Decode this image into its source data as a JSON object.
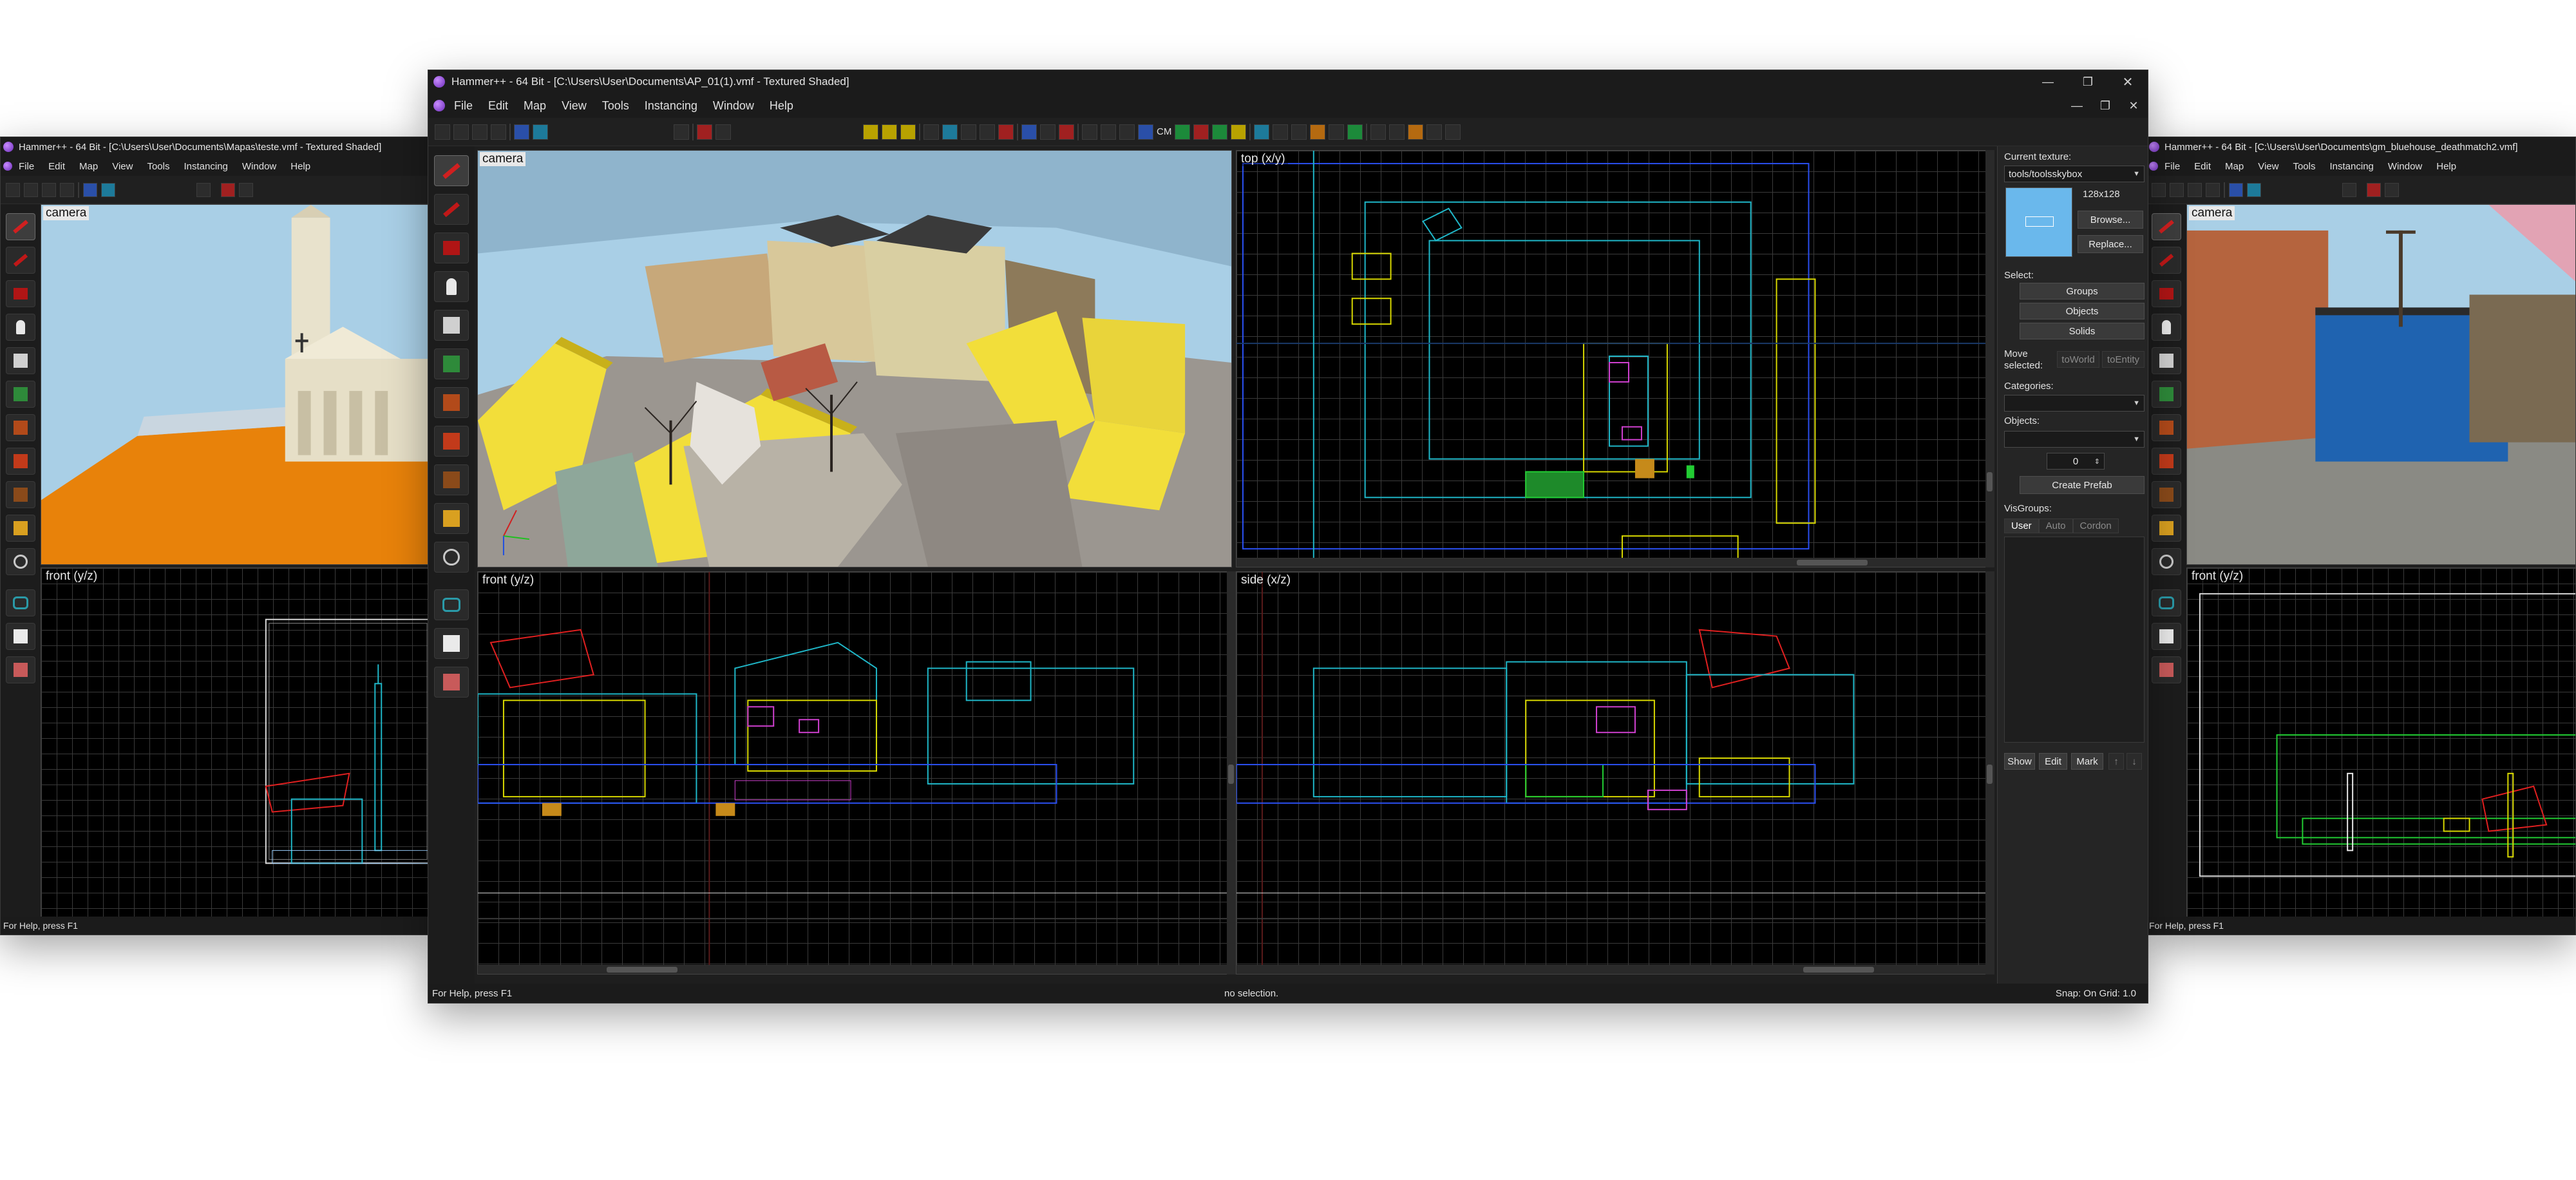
{
  "colors": {
    "window_bg": "#1e1e1e",
    "viewport_bg": "#000000",
    "grid": "#3a3a3a",
    "sky": "#a9cfe6",
    "orange_floor": "#e8820a",
    "wire_cyan": "#1fb7c8",
    "wire_yellow": "#d8d800",
    "wire_red": "#e02020",
    "wire_green": "#22cc33",
    "wire_magenta": "#d040d0",
    "wire_blue": "#2a4ff0"
  },
  "left_window": {
    "title": "Hammer++ - 64 Bit - [C:\\Users\\User\\Documents\\Mapas\\teste.vmf - Textured Shaded]",
    "menus": [
      "File",
      "Edit",
      "Map",
      "View",
      "Tools",
      "Instancing",
      "Window",
      "Help"
    ],
    "viewport_camera_label": "camera",
    "viewport_front_label": "front (y/z)",
    "status_help": "For Help, press F1"
  },
  "main_window": {
    "title": "Hammer++ - 64 Bit - [C:\\Users\\User\\Documents\\AP_01(1).vmf - Textured Shaded]",
    "menus": [
      "File",
      "Edit",
      "Map",
      "View",
      "Tools",
      "Instancing",
      "Window",
      "Help"
    ],
    "toolbar_text": "CM",
    "viewports": {
      "camera": "camera",
      "top": "top (x/y)",
      "front": "front (y/z)",
      "side": "side (x/z)"
    },
    "status": {
      "help": "For Help, press F1",
      "selection": "no selection.",
      "snap": "Snap: On Grid: 1.0"
    },
    "panel": {
      "current_texture_label": "Current texture:",
      "texture_name": "tools/toolsskybox",
      "texture_size": "128x128",
      "browse": "Browse...",
      "replace": "Replace...",
      "select_label": "Select:",
      "groups": "Groups",
      "objects_btn": "Objects",
      "solids": "Solids",
      "move_selected": "Move selected:",
      "to_world": "toWorld",
      "to_entity": "toEntity",
      "categories_label": "Categories:",
      "objects_label": "Objects:",
      "objects_count": "0",
      "create_prefab": "Create Prefab",
      "visgroups_label": "VisGroups:",
      "vis_tabs": [
        "User",
        "Auto",
        "Cordon"
      ],
      "show": "Show",
      "edit": "Edit",
      "mark": "Mark",
      "up_arrow": "↑",
      "down_arrow": "↓"
    }
  },
  "right_window": {
    "title": "Hammer++ - 64 Bit - [C:\\Users\\User\\Documents\\gm_bluehouse_deathmatch2.vmf]",
    "menus": [
      "File",
      "Edit",
      "Map",
      "View",
      "Tools",
      "Instancing",
      "Window",
      "Help"
    ],
    "viewport_camera_label": "camera",
    "viewport_front_label": "front (y/z)",
    "status_help": "For Help, press F1"
  }
}
